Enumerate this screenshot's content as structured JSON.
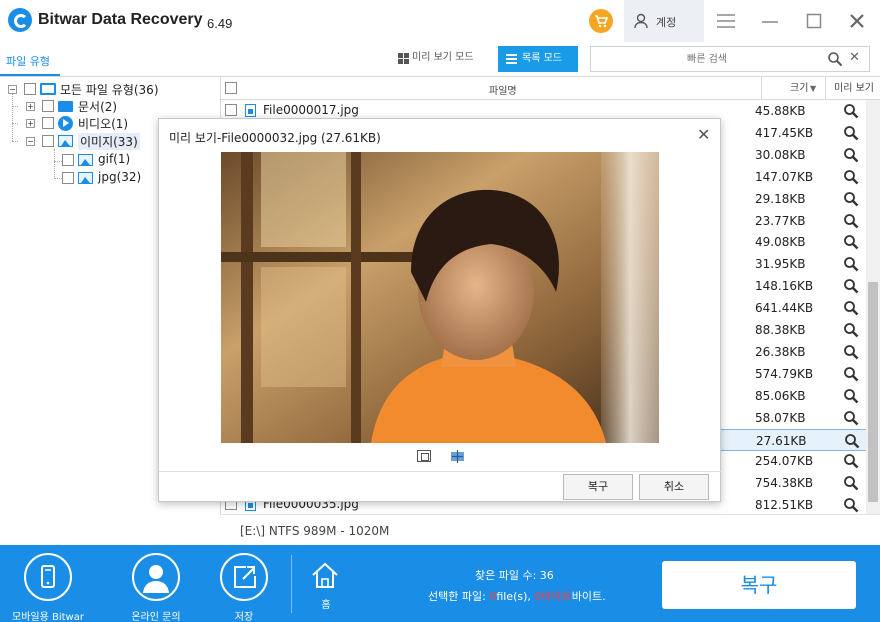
{
  "app": {
    "title": "Bitwar Data Recovery",
    "version": "6.49"
  },
  "header": {
    "account_label": "계정",
    "menu_icon": "hamburger-icon",
    "minimize_icon": "minimize-icon",
    "maximize_icon": "maximize-icon",
    "close_icon": "close-icon"
  },
  "toolbar": {
    "filetype_tab": "파일 유형",
    "preview_mode": "미리 보기 모드",
    "list_mode": "목록 모드",
    "search_placeholder": "빠른 검색"
  },
  "tree": {
    "root": "모든 파일 유형(36)",
    "documents": "문서(2)",
    "videos": "비디오(1)",
    "images": "이미지(33)",
    "gif": "gif(1)",
    "jpg": "jpg(32)"
  },
  "list": {
    "headers": {
      "name": "파일명",
      "size": "크기",
      "preview": "미리 보기"
    },
    "rows": [
      {
        "name": "File0000017.jpg",
        "size": "45.88KB"
      },
      {
        "name": "",
        "size": "417.45KB"
      },
      {
        "name": "",
        "size": "30.08KB"
      },
      {
        "name": "",
        "size": "147.07KB"
      },
      {
        "name": "",
        "size": "29.18KB"
      },
      {
        "name": "",
        "size": "23.77KB"
      },
      {
        "name": "",
        "size": "49.08KB"
      },
      {
        "name": "",
        "size": "31.95KB"
      },
      {
        "name": "",
        "size": "148.16KB"
      },
      {
        "name": "",
        "size": "641.44KB"
      },
      {
        "name": "",
        "size": "88.38KB"
      },
      {
        "name": "",
        "size": "26.38KB"
      },
      {
        "name": "",
        "size": "574.79KB"
      },
      {
        "name": "",
        "size": "85.06KB"
      },
      {
        "name": "",
        "size": "58.07KB"
      },
      {
        "name": "",
        "size": "27.61KB",
        "selected": true
      },
      {
        "name": "",
        "size": "254.07KB"
      },
      {
        "name": "",
        "size": "754.38KB"
      },
      {
        "name": "File0000035.jpg",
        "size": "812.51KB"
      }
    ]
  },
  "status": {
    "drive": "[E:\\] NTFS 989M - 1020M"
  },
  "dialog": {
    "title": "미리 보기-File0000032.jpg (27.61KB)",
    "recover": "복구",
    "cancel": "취소"
  },
  "bottom": {
    "mobile": "모바일용 Bitwar",
    "support": "온라인 문의",
    "save": "저장",
    "home": "홈",
    "found_prefix": "찾은 파일 수: ",
    "found_count": "36",
    "selected_prefix": "선택한 파일: ",
    "selected_files": "0",
    "selected_files_suffix": "file(s), ",
    "selected_bytes": "0바이트",
    "selected_bytes_suffix": "바이트.",
    "recover": "복구"
  },
  "colors": {
    "accent": "#1a8ee6",
    "warning": "#f5a623",
    "highlight": "#ff3b3b"
  }
}
